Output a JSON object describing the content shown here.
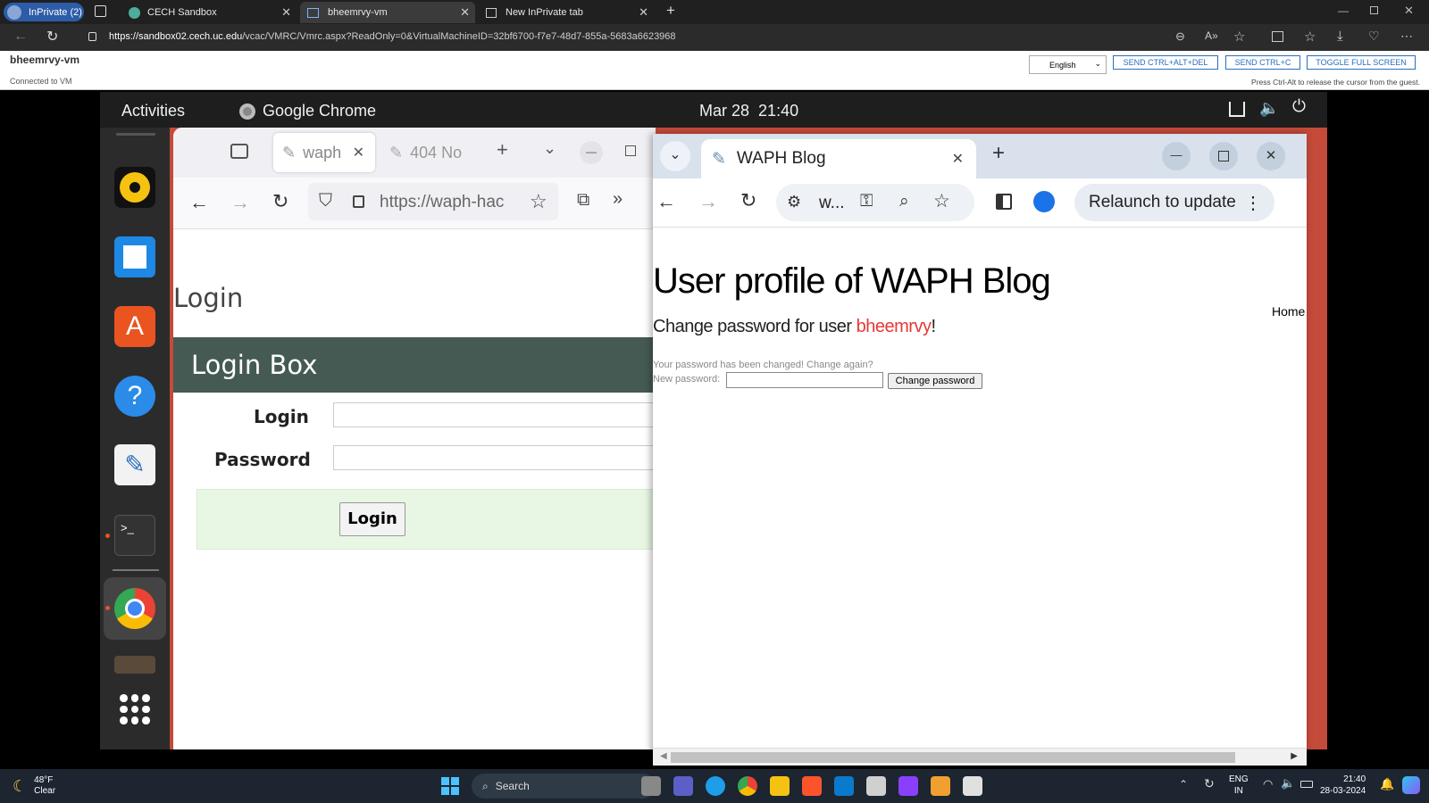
{
  "edge": {
    "inprivate_label": "InPrivate (2)",
    "tabs": [
      {
        "label": "CECH Sandbox"
      },
      {
        "label": "bheemrvy-vm"
      },
      {
        "label": "New InPrivate tab"
      }
    ],
    "url_domain": "https://sandbox02.cech.uc.edu",
    "url_path": "/vcac/VMRC/Vmrc.aspx?ReadOnly=0&VirtualMachineID=32bf6700-f7e7-48d7-855a-5683a6623968"
  },
  "vmrc": {
    "vm_name": "bheemrvy-vm",
    "status": "Connected to VM",
    "language": "English",
    "buttons": {
      "ctrl_alt_del": "SEND CTRL+ALT+DEL",
      "ctrl_c": "SEND CTRL+C",
      "fullscreen": "TOGGLE FULL SCREEN"
    },
    "hint": "Press Ctrl-Alt to release the cursor from the guest."
  },
  "gnome": {
    "activities": "Activities",
    "app_name": "Google Chrome",
    "date": "Mar 28",
    "time": "21:40"
  },
  "firefox": {
    "tabs": [
      {
        "label": "waph"
      },
      {
        "label": "404 No"
      }
    ],
    "url": "https://waph-hac",
    "page": {
      "heading": "Login",
      "box_title": "Login Box",
      "login_label": "Login",
      "password_label": "Password",
      "login_button": "Login"
    }
  },
  "chrome": {
    "tab_title": "WAPH Blog",
    "omnibox": "w...",
    "relaunch": "Relaunch to update",
    "page": {
      "title": "User profile of WAPH Blog",
      "home_link": "Home",
      "change_prefix": "Change password for user ",
      "username": "bheemrvy",
      "change_suffix": "!",
      "notice": "Your password has been changed! Change again?",
      "new_password_label": "New password:",
      "submit": "Change password"
    }
  },
  "taskbar": {
    "weather_temp": "48°F",
    "weather_cond": "Clear",
    "search": "Search",
    "lang_top": "ENG",
    "lang_bottom": "IN",
    "time": "21:40",
    "date": "28-03-2024"
  },
  "colors": {
    "edge_dark": "#202020",
    "inprivate": "#2d5ca8",
    "vmrc_blue": "#2a6ebb",
    "login_box_header": "#455a53",
    "login_row_bg": "#e8f7e3",
    "username_red": "#e53935",
    "taskbar": "#1c2530"
  }
}
